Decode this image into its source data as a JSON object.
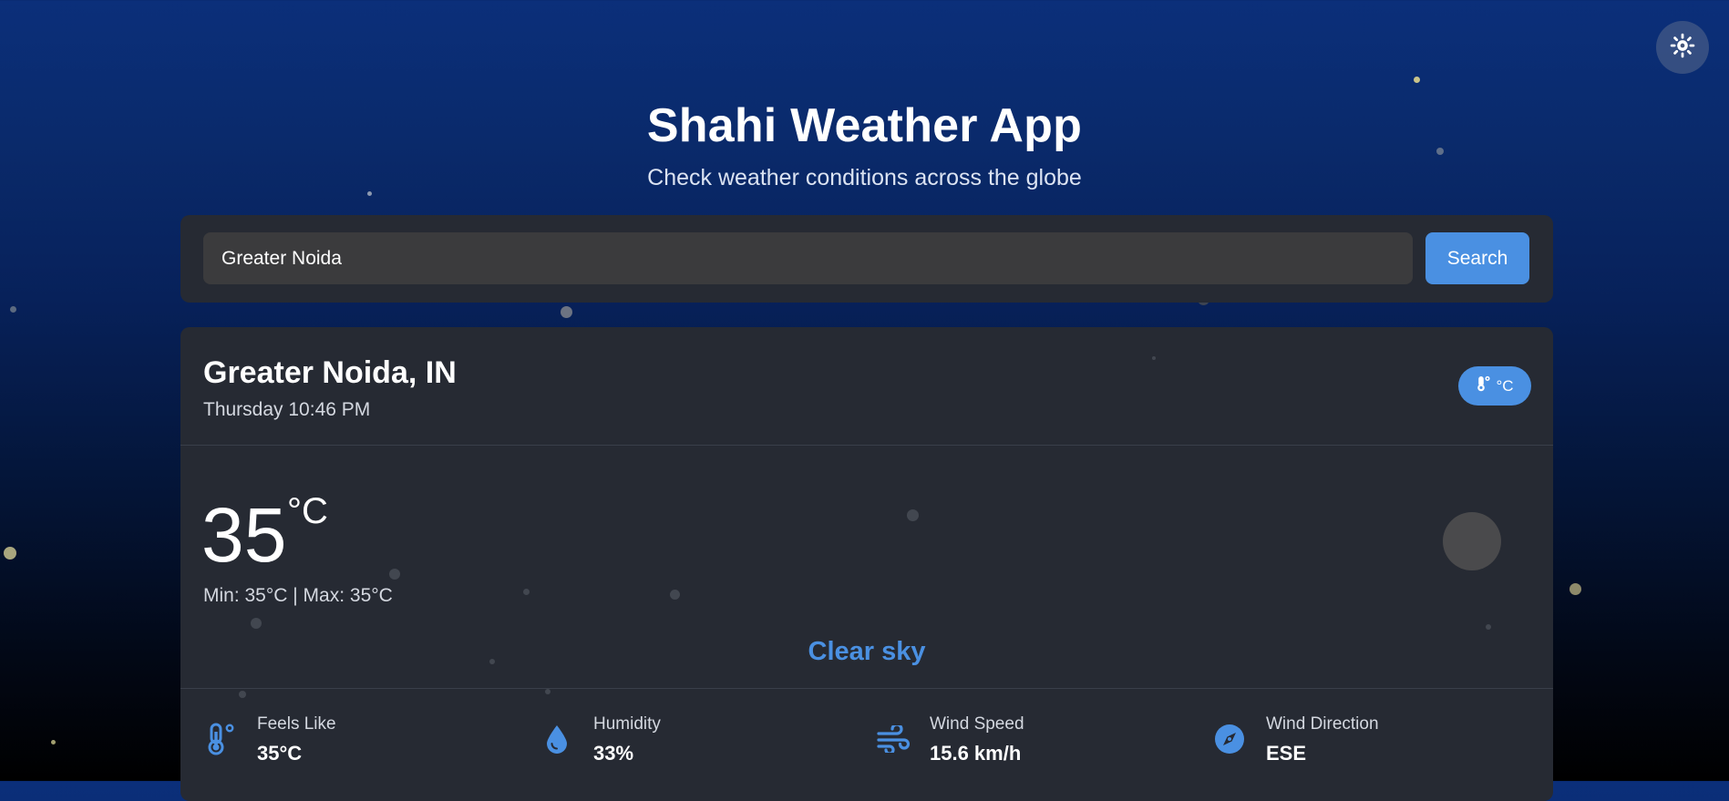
{
  "header": {
    "title": "Shahi Weather App",
    "subtitle": "Check weather conditions across the globe"
  },
  "theme_toggle": {
    "icon": "sun-icon"
  },
  "search": {
    "value": "Greater Noida",
    "button_label": "Search"
  },
  "weather": {
    "location": "Greater Noida, IN",
    "datetime": "Thursday 10:46 PM",
    "unit_toggle_label": "°C",
    "unit_toggle_icon": "thermometer-icon",
    "temperature": "35",
    "temperature_unit": "°C",
    "minmax": "Min: 35°C | Max: 35°C",
    "condition": "Clear sky",
    "condition_icon": "weather-condition-icon"
  },
  "details": [
    {
      "label": "Feels Like",
      "value": "35°C",
      "icon": "thermometer-icon"
    },
    {
      "label": "Humidity",
      "value": "33%",
      "icon": "water-drop-icon"
    },
    {
      "label": "Wind Speed",
      "value": "15.6 km/h",
      "icon": "wind-icon"
    },
    {
      "label": "Wind Direction",
      "value": "ESE",
      "icon": "compass-icon"
    }
  ],
  "colors": {
    "accent": "#4a90e2",
    "panel": "#262a33",
    "input_bg": "#3b3b3d",
    "background_top": "#0b2f7a",
    "background_bottom": "#000000"
  }
}
